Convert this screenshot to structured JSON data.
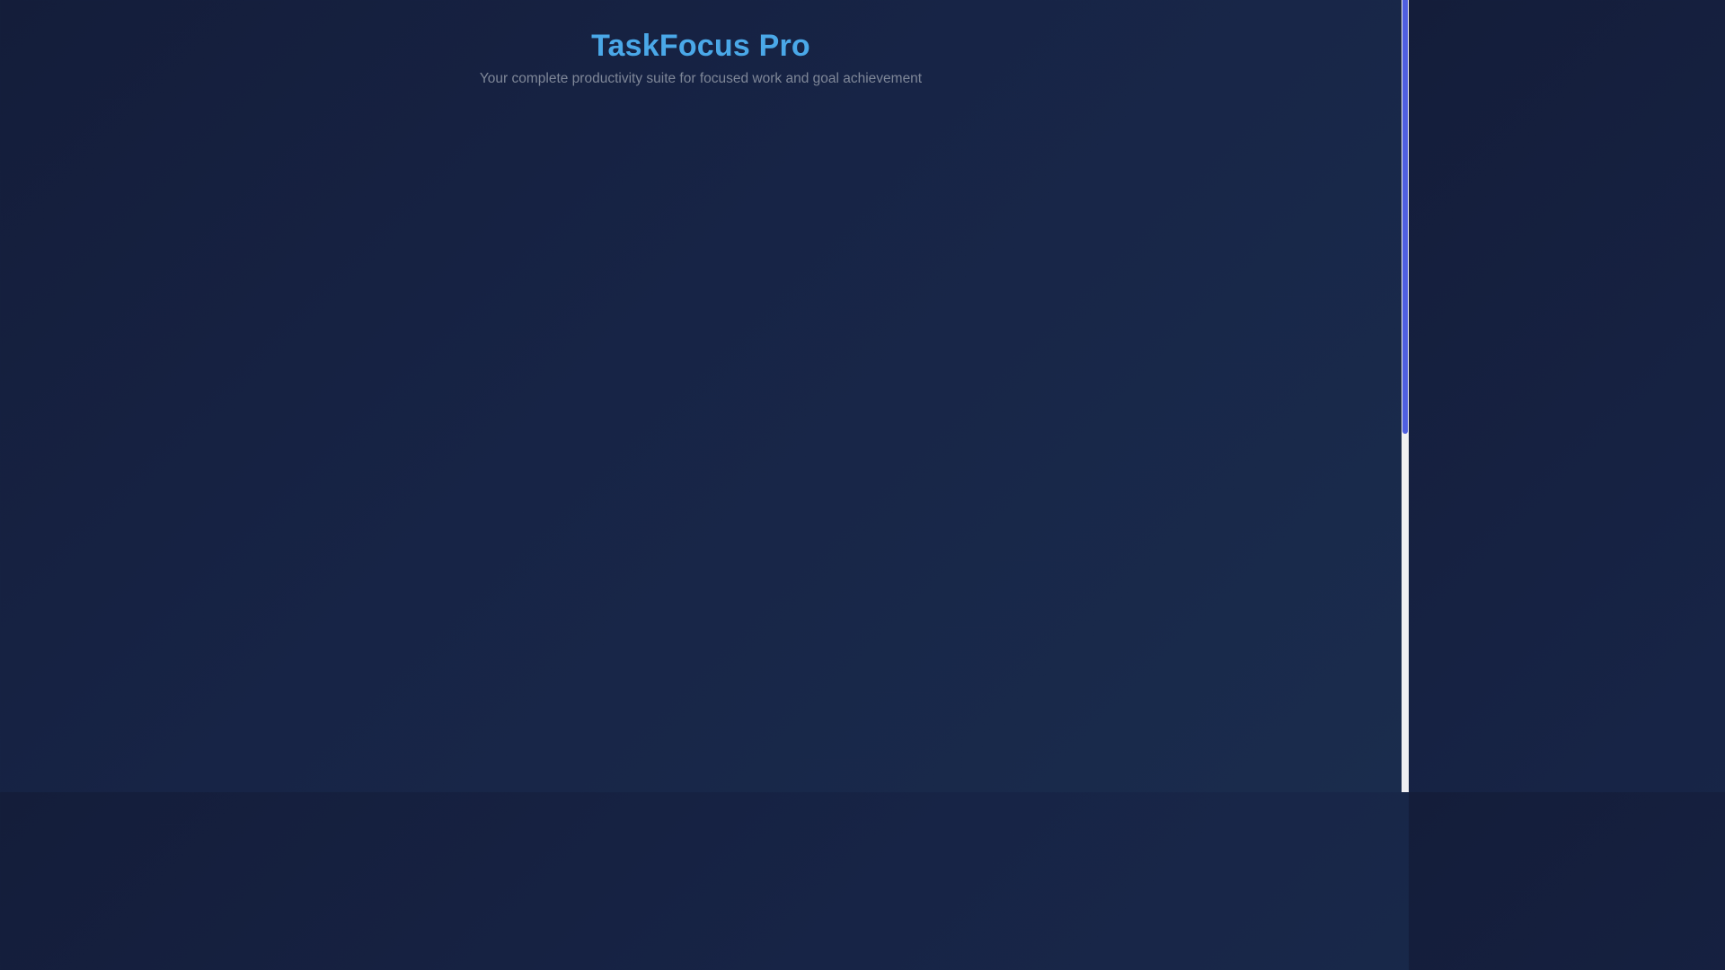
{
  "header": {
    "title": "TaskFocus Pro",
    "subtitle": "Your complete productivity suite for focused work and goal achievement"
  },
  "colors": {
    "background_start": "#141d3a",
    "background_end": "#1a2c4d",
    "title_accent": "#4aa8e8",
    "subtitle_text": "#7f8798",
    "scrollbar_thumb": "#4f5fe0",
    "scrollbar_track": "#f0f0f2"
  }
}
